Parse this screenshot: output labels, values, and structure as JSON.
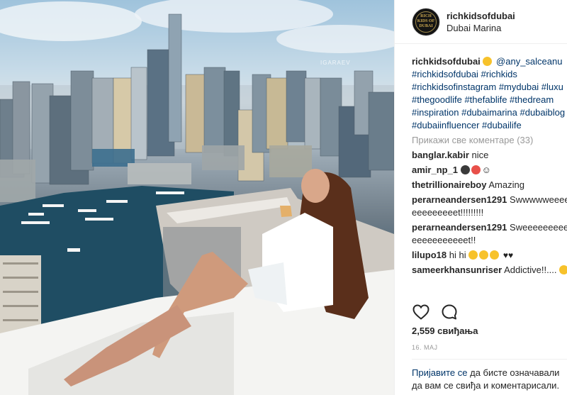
{
  "photo": {
    "alt_watermark": "IGARAEV"
  },
  "header": {
    "username": "richkidsofdubai",
    "location": "Dubai Marina",
    "avatar_text": "RICH KIDS OF DUBAI"
  },
  "caption": {
    "username": "richkidsofdubai",
    "mention": "@any_salceanu",
    "lines": [
      "#richkidsofdubai #richkids",
      "#richkidsofinstagram #mydubai #luxu",
      "#thegoodlife #thefablife #thedream",
      "#inspiration #dubaimarina #dubaiblog",
      "#dubaiinfluencer #dubailife"
    ]
  },
  "view_all_comments": "Прикажи све коментаре (33)",
  "comments": [
    {
      "user": "banglar.kabir",
      "text": "nice"
    },
    {
      "user": "amir_np_1",
      "text": ""
    },
    {
      "user": "thetrillionaireboy",
      "text": "Amazing"
    },
    {
      "user": "perarneandersen1291",
      "text": "Swwwwweeeeeeeeeeeeeeet!!!!!!!!!"
    },
    {
      "user": "perarneandersen1291",
      "text": "Sweeeeeeeeeeeeeeeeeeeeeet!!"
    },
    {
      "user": "lilupo18",
      "text": "hi hi"
    },
    {
      "user": "sameerkhansunriser",
      "text": "Addictive!!...."
    }
  ],
  "likes_label": "2,559 свиђања",
  "date_label": "16. МАЈ",
  "login": {
    "link": "Пријавите се",
    "rest": " да бисте означавали да вам се свиђа и коментарисали."
  },
  "icons": {
    "like": "heart-outline-icon",
    "comment": "speech-bubble-icon"
  },
  "colors": {
    "link": "#003569",
    "muted": "#999999",
    "text": "#262626"
  }
}
